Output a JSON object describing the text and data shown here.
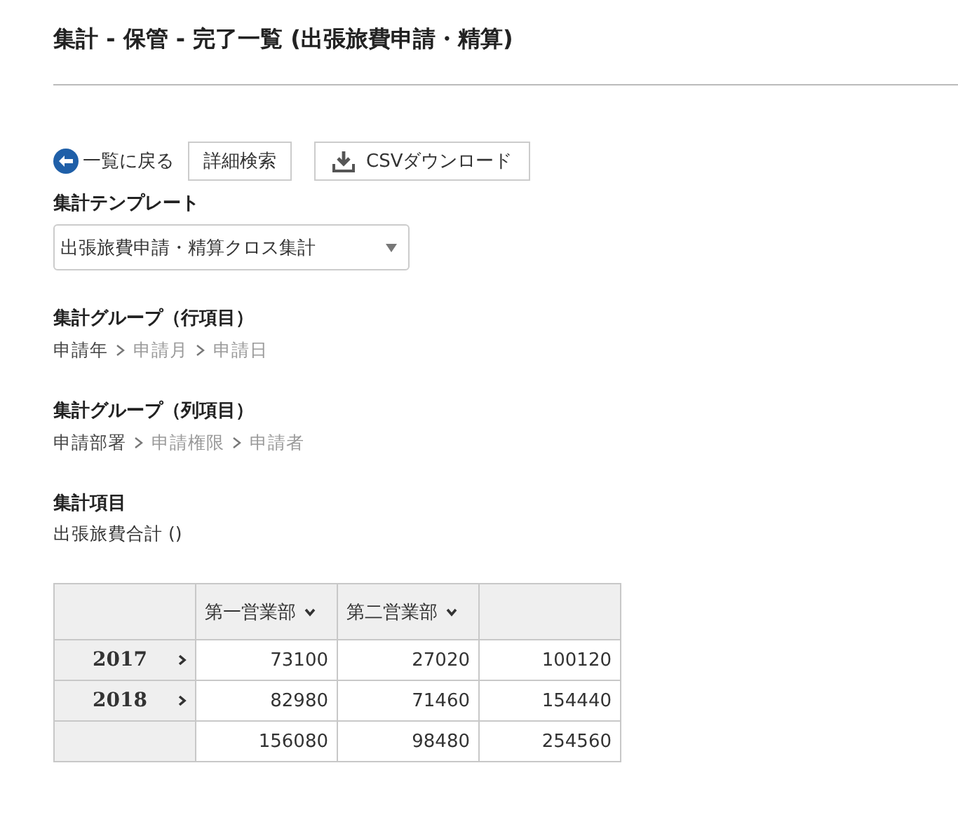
{
  "title": "集計 - 保管 - 完了一覧 (出張旅費申請・精算)",
  "toolbar": {
    "back_link": "一覧に戻る",
    "buttons": [
      {
        "label": "詳細検索",
        "kind": "plain"
      },
      {
        "label": "CSVダウンロード",
        "kind": "download"
      }
    ]
  },
  "template": {
    "label": "集計テンプレート",
    "value": "出張旅費申請・精算クロス集計"
  },
  "row_group": {
    "label": "集計グループ（行項目）",
    "path": [
      {
        "text": "申請年",
        "selected": true
      },
      {
        "text": "申請月",
        "selected": false
      },
      {
        "text": "申請日",
        "selected": false
      }
    ]
  },
  "column_group": {
    "label": "集計グループ（列項目）",
    "path": [
      {
        "text": "申請部署",
        "selected": true
      },
      {
        "text": "申請権限",
        "selected": false
      },
      {
        "text": "申請者",
        "selected": false
      }
    ]
  },
  "measure": {
    "label": "集計項目",
    "value": "出張旅費合計 ()"
  },
  "table": {
    "columns": [
      "第一営業部",
      "第二営業部"
    ],
    "rows": [
      {
        "label": "2017",
        "values": [
          "73100",
          "27020",
          "100120"
        ]
      },
      {
        "label": "2018",
        "values": [
          "82980",
          "71460",
          "154440"
        ]
      }
    ],
    "totals": [
      "156080",
      "98480",
      "254560"
    ]
  }
}
